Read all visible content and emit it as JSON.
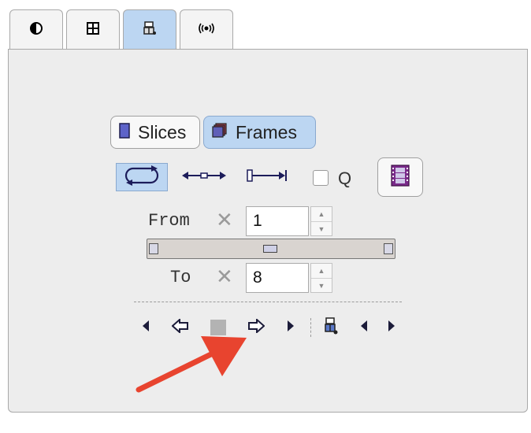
{
  "tabs": [
    {
      "icon": "contrast-icon",
      "active": false
    },
    {
      "icon": "grid-layout-icon",
      "active": false
    },
    {
      "icon": "cine-tool-icon",
      "active": true
    },
    {
      "icon": "signal-icon",
      "active": false
    }
  ],
  "mode": {
    "slices_label": "Slices",
    "frames_label": "Frames",
    "selected": "Frames"
  },
  "playback_modes": {
    "q_label": "Q",
    "q_checked": false
  },
  "range": {
    "from_label": "From",
    "from_value": "1",
    "to_label": "To",
    "to_value": "8"
  },
  "annotation": {
    "arrow_color": "#e8442f"
  }
}
